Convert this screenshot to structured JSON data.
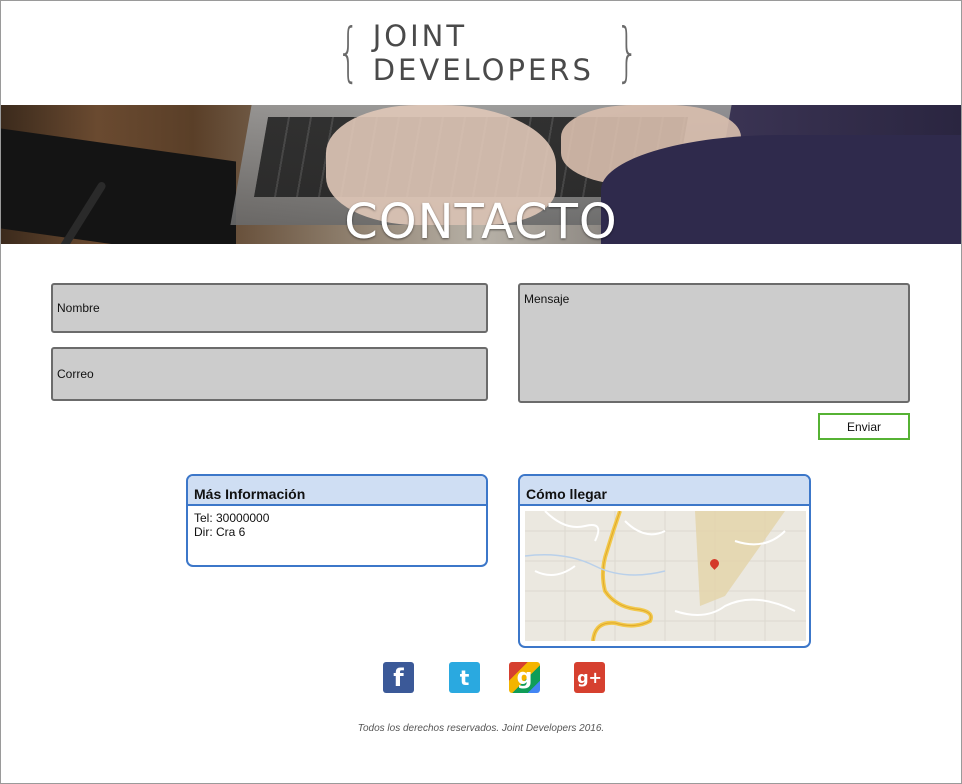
{
  "header": {
    "logo_text": "JOINT DEVELOPERS",
    "brace_left": "{",
    "brace_right": "}"
  },
  "banner": {
    "title": "CONTACTO"
  },
  "form": {
    "name_placeholder": "Nombre",
    "email_placeholder": "Correo",
    "message_placeholder": "Mensaje",
    "submit_label": "Enviar"
  },
  "info": {
    "title": "Más Información",
    "phone": "Tel: 30000000",
    "address": "Dir: Cra 6"
  },
  "directions": {
    "title": "Cómo llegar",
    "map_icon": "map-pin-icon"
  },
  "social": [
    {
      "name": "facebook",
      "glyph": "f",
      "color": "#3b5998"
    },
    {
      "name": "twitter",
      "glyph": "t",
      "color": "#2aa9e0"
    },
    {
      "name": "google",
      "glyph": "g",
      "color": "#3a7f3a"
    },
    {
      "name": "google-plus",
      "glyph": "g+",
      "color": "#d6402f"
    }
  ],
  "footer": {
    "text": "Todos los derechos reservados. Joint Developers 2016."
  }
}
